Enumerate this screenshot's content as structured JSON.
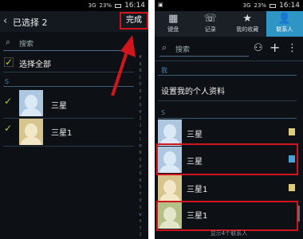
{
  "left": {
    "status": {
      "left": "3G",
      "battery": "23%",
      "time": "16:14"
    },
    "header": {
      "selected_count": "已选择 2",
      "done": "完成"
    },
    "search": {
      "placeholder": "搜索"
    },
    "select_all": "选择全部",
    "section": "S",
    "contacts": [
      {
        "name": "三星"
      },
      {
        "name": "三星1"
      }
    ]
  },
  "right": {
    "status": {
      "left": "3G",
      "battery": "23%",
      "time": "16:14"
    },
    "tabs": [
      {
        "label": "键盘",
        "icon": "keypad-icon"
      },
      {
        "label": "记录",
        "icon": "call-log-icon"
      },
      {
        "label": "我的收藏",
        "icon": "star-icon"
      },
      {
        "label": "联系人",
        "icon": "person-icon"
      }
    ],
    "search": {
      "placeholder": "搜索"
    },
    "me_section": "我",
    "setup_profile": "设置我的个人资料",
    "section": "S",
    "contacts": [
      {
        "name": "三星"
      },
      {
        "name": "三星"
      },
      {
        "name": "三星1"
      },
      {
        "name": "三星1"
      }
    ],
    "footer": "显示4个联系人"
  },
  "alphabet": "#ABCDEFGHIJKLMNOPQRSTUVWXYZ",
  "colors": {
    "highlight": "#d0151c",
    "accent_tab": "#2f95c4",
    "check": "#a6d11b"
  }
}
